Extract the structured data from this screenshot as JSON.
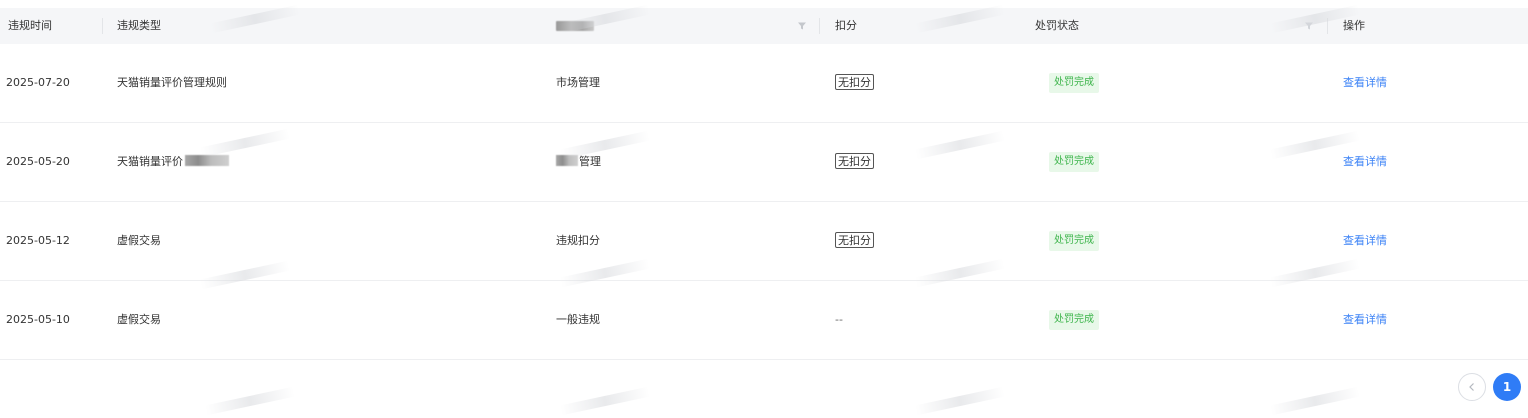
{
  "table": {
    "columns": {
      "time": "违规时间",
      "type": "违规类型",
      "category": "",
      "deduction": "扣分",
      "status": "处罚状态",
      "action": "操作"
    },
    "rows": [
      {
        "time": "2025-07-20",
        "type": "天猫销量评价管理规则",
        "category": "市场管理",
        "deduction": "无扣分",
        "status": "处罚完成",
        "action": "查看详情"
      },
      {
        "time": "2025-05-20",
        "type": "天猫销量评价",
        "category": "管理",
        "deduction": "无扣分",
        "status": "处罚完成",
        "action": "查看详情"
      },
      {
        "time": "2025-05-12",
        "type": "虚假交易",
        "category": "违规扣分",
        "deduction": "无扣分",
        "status": "处罚完成",
        "action": "查看详情"
      },
      {
        "time": "2025-05-10",
        "type": "虚假交易",
        "category": "一般违规",
        "deduction": "--",
        "status": "处罚完成",
        "action": "查看详情"
      }
    ]
  },
  "pagination": {
    "current_page": "1"
  },
  "icons": {
    "filter": "filter-icon",
    "prev": "chevron-left-icon"
  },
  "colors": {
    "link": "#3b82f6",
    "status_text": "#3cb44a",
    "status_bg": "#e8f8e9",
    "page_active": "#2f7cf6",
    "header_bg": "#f5f6f8"
  }
}
